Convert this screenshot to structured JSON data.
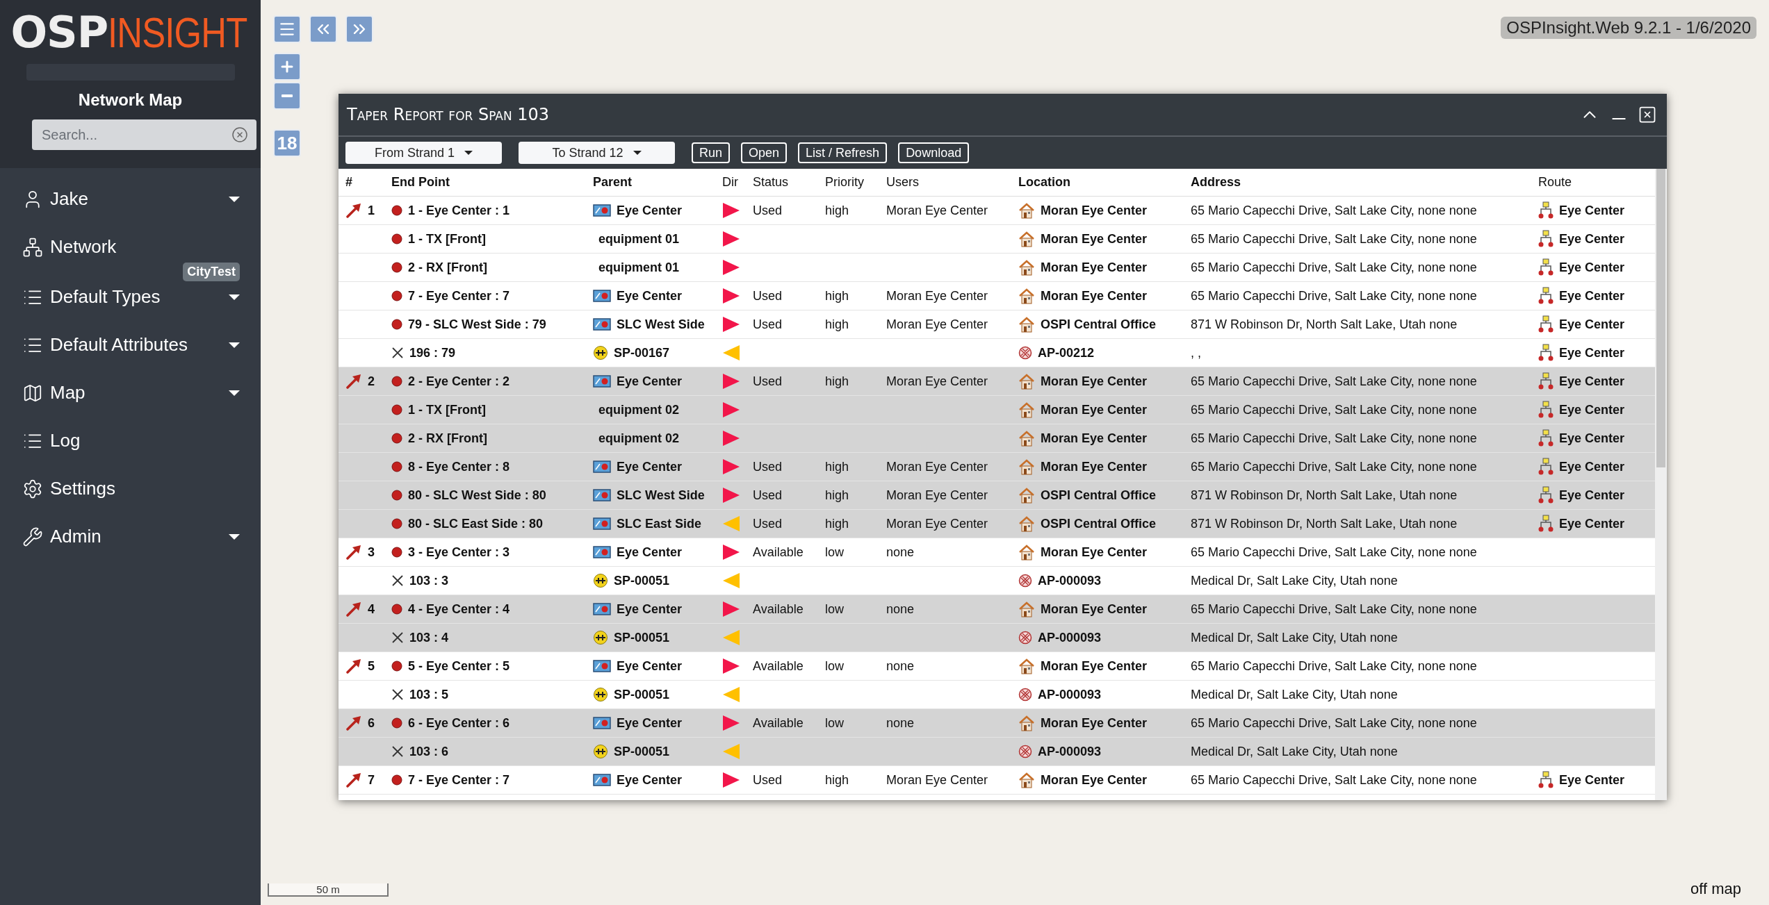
{
  "sidebar": {
    "logo": {
      "bold": "OSP",
      "light": "INSIGHT"
    },
    "title": "Network Map",
    "search": {
      "placeholder": "Search..."
    },
    "items": [
      {
        "label": "Jake",
        "expandable": true
      },
      {
        "label": "Network",
        "expandable": false,
        "badge": "CityTest"
      },
      {
        "label": "Default Types",
        "expandable": true
      },
      {
        "label": "Default Attributes",
        "expandable": true
      },
      {
        "label": "Map",
        "expandable": true
      },
      {
        "label": "Log",
        "expandable": false
      },
      {
        "label": "Settings",
        "expandable": false
      },
      {
        "label": "Admin",
        "expandable": true
      }
    ]
  },
  "map": {
    "zoom_level": "18",
    "version": "OSPInsight.Web 9.2.1 - 1/6/2020",
    "scale": "50 m",
    "status": "off map"
  },
  "dialog": {
    "title": "Taper Report for Span 103",
    "dropdowns": [
      "From Strand 1",
      "To Strand 12"
    ],
    "buttons": [
      "Run",
      "Open",
      "List / Refresh",
      "Download"
    ],
    "columns": [
      {
        "label": "#",
        "bold": true
      },
      {
        "label": "End Point",
        "bold": true
      },
      {
        "label": "Parent",
        "bold": true
      },
      {
        "label": "Dir",
        "bold": false
      },
      {
        "label": "Status",
        "bold": false
      },
      {
        "label": "Priority",
        "bold": false
      },
      {
        "label": "Users",
        "bold": false
      },
      {
        "label": "Location",
        "bold": true
      },
      {
        "label": "Address",
        "bold": true
      },
      {
        "label": "Route",
        "bold": false
      }
    ],
    "groups": [
      {
        "rows": [
          {
            "num": "1",
            "end_point": {
              "kind": "port",
              "text": "1 - Eye Center : 1"
            },
            "parent": {
              "kind": "panel",
              "text": "Eye Center"
            },
            "reverse": false,
            "status": "Used",
            "priority": "high",
            "users": "Moran Eye Center",
            "location": {
              "kind": "site",
              "text": "Moran Eye Center"
            },
            "address": "65 Mario Capecchi Drive, Salt Lake City, none none",
            "route": "Eye Center"
          },
          {
            "end_point": {
              "kind": "port",
              "text": "1 - TX [Front]"
            },
            "parent": {
              "kind": "equipment",
              "text": "equipment 01"
            },
            "reverse": false,
            "location": {
              "kind": "site",
              "text": "Moran Eye Center"
            },
            "address": "65 Mario Capecchi Drive, Salt Lake City, none none",
            "route": "Eye Center"
          },
          {
            "end_point": {
              "kind": "port",
              "text": "2 - RX [Front]"
            },
            "parent": {
              "kind": "equipment",
              "text": "equipment 01"
            },
            "reverse": false,
            "location": {
              "kind": "site",
              "text": "Moran Eye Center"
            },
            "address": "65 Mario Capecchi Drive, Salt Lake City, none none",
            "route": "Eye Center"
          },
          {
            "end_point": {
              "kind": "port",
              "text": "7 - Eye Center : 7"
            },
            "parent": {
              "kind": "panel",
              "text": "Eye Center"
            },
            "reverse": false,
            "status": "Used",
            "priority": "high",
            "users": "Moran Eye Center",
            "location": {
              "kind": "site",
              "text": "Moran Eye Center"
            },
            "address": "65 Mario Capecchi Drive, Salt Lake City, none none",
            "route": "Eye Center"
          },
          {
            "end_point": {
              "kind": "port",
              "text": "79 - SLC West Side : 79"
            },
            "parent": {
              "kind": "panel",
              "text": "SLC West Side"
            },
            "reverse": false,
            "status": "Used",
            "priority": "high",
            "users": "Moran Eye Center",
            "location": {
              "kind": "site",
              "text": "OSPI Central Office"
            },
            "address": "871 W Robinson Dr, North Salt Lake, Utah none",
            "route": "Eye Center"
          },
          {
            "end_point": {
              "kind": "splice",
              "text": "196 : 79"
            },
            "parent": {
              "kind": "splice",
              "text": "SP-00167"
            },
            "reverse": true,
            "location": {
              "kind": "access_point",
              "text": "AP-00212"
            },
            "address": ", ,",
            "route": "Eye Center"
          }
        ]
      },
      {
        "rows": [
          {
            "num": "2",
            "end_point": {
              "kind": "port",
              "text": "2 - Eye Center : 2"
            },
            "parent": {
              "kind": "panel",
              "text": "Eye Center"
            },
            "reverse": false,
            "status": "Used",
            "priority": "high",
            "users": "Moran Eye Center",
            "location": {
              "kind": "site",
              "text": "Moran Eye Center"
            },
            "address": "65 Mario Capecchi Drive, Salt Lake City, none none",
            "route": "Eye Center"
          },
          {
            "end_point": {
              "kind": "port",
              "text": "1 - TX [Front]"
            },
            "parent": {
              "kind": "equipment",
              "text": "equipment 02"
            },
            "reverse": false,
            "location": {
              "kind": "site",
              "text": "Moran Eye Center"
            },
            "address": "65 Mario Capecchi Drive, Salt Lake City, none none",
            "route": "Eye Center"
          },
          {
            "end_point": {
              "kind": "port",
              "text": "2 - RX [Front]"
            },
            "parent": {
              "kind": "equipment",
              "text": "equipment 02"
            },
            "reverse": false,
            "location": {
              "kind": "site",
              "text": "Moran Eye Center"
            },
            "address": "65 Mario Capecchi Drive, Salt Lake City, none none",
            "route": "Eye Center"
          },
          {
            "end_point": {
              "kind": "port",
              "text": "8 - Eye Center : 8"
            },
            "parent": {
              "kind": "panel",
              "text": "Eye Center"
            },
            "reverse": false,
            "status": "Used",
            "priority": "high",
            "users": "Moran Eye Center",
            "location": {
              "kind": "site",
              "text": "Moran Eye Center"
            },
            "address": "65 Mario Capecchi Drive, Salt Lake City, none none",
            "route": "Eye Center"
          },
          {
            "end_point": {
              "kind": "port",
              "text": "80 - SLC West Side : 80"
            },
            "parent": {
              "kind": "panel",
              "text": "SLC West Side"
            },
            "reverse": false,
            "status": "Used",
            "priority": "high",
            "users": "Moran Eye Center",
            "location": {
              "kind": "site",
              "text": "OSPI Central Office"
            },
            "address": "871 W Robinson Dr, North Salt Lake, Utah none",
            "route": "Eye Center"
          },
          {
            "end_point": {
              "kind": "port",
              "text": "80 - SLC East Side : 80"
            },
            "parent": {
              "kind": "panel",
              "text": "SLC East Side"
            },
            "reverse": true,
            "status": "Used",
            "priority": "high",
            "users": "Moran Eye Center",
            "location": {
              "kind": "site",
              "text": "OSPI Central Office"
            },
            "address": "871 W Robinson Dr, North Salt Lake, Utah none",
            "route": "Eye Center"
          }
        ]
      },
      {
        "rows": [
          {
            "num": "3",
            "end_point": {
              "kind": "port",
              "text": "3 - Eye Center : 3"
            },
            "parent": {
              "kind": "panel",
              "text": "Eye Center"
            },
            "reverse": false,
            "status": "Available",
            "priority": "low",
            "users": "none",
            "location": {
              "kind": "site",
              "text": "Moran Eye Center"
            },
            "address": "65 Mario Capecchi Drive, Salt Lake City, none none"
          },
          {
            "end_point": {
              "kind": "splice",
              "text": "103 : 3"
            },
            "parent": {
              "kind": "splice",
              "text": "SP-00051"
            },
            "reverse": true,
            "location": {
              "kind": "access_point",
              "text": "AP-000093"
            },
            "address": "Medical Dr, Salt Lake City, Utah none"
          }
        ]
      },
      {
        "rows": [
          {
            "num": "4",
            "end_point": {
              "kind": "port",
              "text": "4 - Eye Center : 4"
            },
            "parent": {
              "kind": "panel",
              "text": "Eye Center"
            },
            "reverse": false,
            "status": "Available",
            "priority": "low",
            "users": "none",
            "location": {
              "kind": "site",
              "text": "Moran Eye Center"
            },
            "address": "65 Mario Capecchi Drive, Salt Lake City, none none"
          },
          {
            "end_point": {
              "kind": "splice",
              "text": "103 : 4"
            },
            "parent": {
              "kind": "splice",
              "text": "SP-00051"
            },
            "reverse": true,
            "location": {
              "kind": "access_point",
              "text": "AP-000093"
            },
            "address": "Medical Dr, Salt Lake City, Utah none"
          }
        ]
      },
      {
        "rows": [
          {
            "num": "5",
            "end_point": {
              "kind": "port",
              "text": "5 - Eye Center : 5"
            },
            "parent": {
              "kind": "panel",
              "text": "Eye Center"
            },
            "reverse": false,
            "status": "Available",
            "priority": "low",
            "users": "none",
            "location": {
              "kind": "site",
              "text": "Moran Eye Center"
            },
            "address": "65 Mario Capecchi Drive, Salt Lake City, none none"
          },
          {
            "end_point": {
              "kind": "splice",
              "text": "103 : 5"
            },
            "parent": {
              "kind": "splice",
              "text": "SP-00051"
            },
            "reverse": true,
            "location": {
              "kind": "access_point",
              "text": "AP-000093"
            },
            "address": "Medical Dr, Salt Lake City, Utah none"
          }
        ]
      },
      {
        "rows": [
          {
            "num": "6",
            "end_point": {
              "kind": "port",
              "text": "6 - Eye Center : 6"
            },
            "parent": {
              "kind": "panel",
              "text": "Eye Center"
            },
            "reverse": false,
            "status": "Available",
            "priority": "low",
            "users": "none",
            "location": {
              "kind": "site",
              "text": "Moran Eye Center"
            },
            "address": "65 Mario Capecchi Drive, Salt Lake City, none none"
          },
          {
            "end_point": {
              "kind": "splice",
              "text": "103 : 6"
            },
            "parent": {
              "kind": "splice",
              "text": "SP-00051"
            },
            "reverse": true,
            "location": {
              "kind": "access_point",
              "text": "AP-000093"
            },
            "address": "Medical Dr, Salt Lake City, Utah none"
          }
        ]
      },
      {
        "rows": [
          {
            "num": "7",
            "end_point": {
              "kind": "port",
              "text": "7 - Eye Center : 7"
            },
            "parent": {
              "kind": "panel",
              "text": "Eye Center"
            },
            "reverse": false,
            "status": "Used",
            "priority": "high",
            "users": "Moran Eye Center",
            "location": {
              "kind": "site",
              "text": "Moran Eye Center"
            },
            "address": "65 Mario Capecchi Drive, Salt Lake City, none none",
            "route": "Eye Center"
          }
        ]
      }
    ]
  }
}
